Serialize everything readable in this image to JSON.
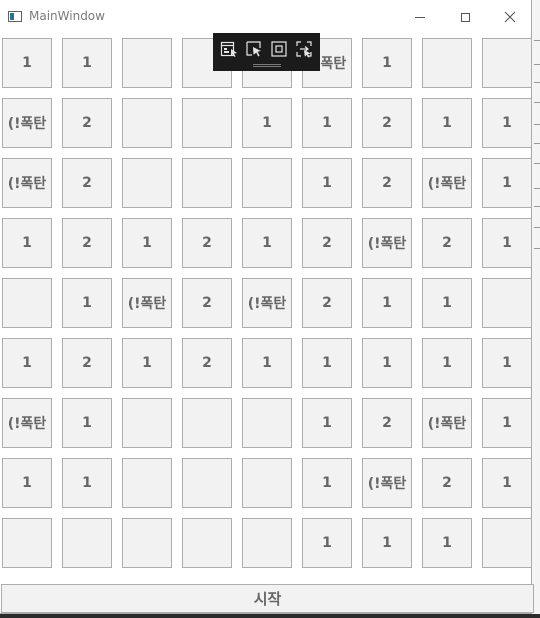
{
  "window": {
    "title": "MainWindow",
    "controls": {
      "minimize": "minimize-icon",
      "maximize": "maximize-icon",
      "close": "close-icon"
    }
  },
  "board": {
    "rows": 9,
    "cols": 9,
    "cells": [
      [
        "1",
        "1",
        "",
        "",
        "",
        "(!폭탄",
        "1",
        "",
        ""
      ],
      [
        "(!폭탄",
        "2",
        "",
        "",
        "1",
        "1",
        "2",
        "1",
        "1"
      ],
      [
        "(!폭탄",
        "2",
        "",
        "",
        "",
        "1",
        "2",
        "(!폭탄",
        "1"
      ],
      [
        "1",
        "2",
        "1",
        "2",
        "1",
        "2",
        "(!폭탄",
        "2",
        "1"
      ],
      [
        "",
        "1",
        "(!폭탄",
        "2",
        "(!폭탄",
        "2",
        "1",
        "1",
        ""
      ],
      [
        "1",
        "2",
        "1",
        "2",
        "1",
        "1",
        "1",
        "1",
        "1"
      ],
      [
        "(!폭탄",
        "1",
        "",
        "",
        "",
        "1",
        "2",
        "(!폭탄",
        "1"
      ],
      [
        "1",
        "1",
        "",
        "",
        "",
        "1",
        "(!폭탄",
        "2",
        "1"
      ],
      [
        "",
        "",
        "",
        "",
        "",
        "1",
        "1",
        "1",
        ""
      ]
    ]
  },
  "start_button": {
    "label": "시작"
  },
  "debug_toolbar": {
    "buttons": [
      "live-visual-tree-icon",
      "select-element-icon",
      "display-layout-adorners-icon",
      "track-focused-element-icon"
    ]
  },
  "colors": {
    "cell_background": "#f2f2f2",
    "cell_border": "#adadad",
    "cell_text": "#666666",
    "toolbar_background": "#1b1b1b"
  }
}
